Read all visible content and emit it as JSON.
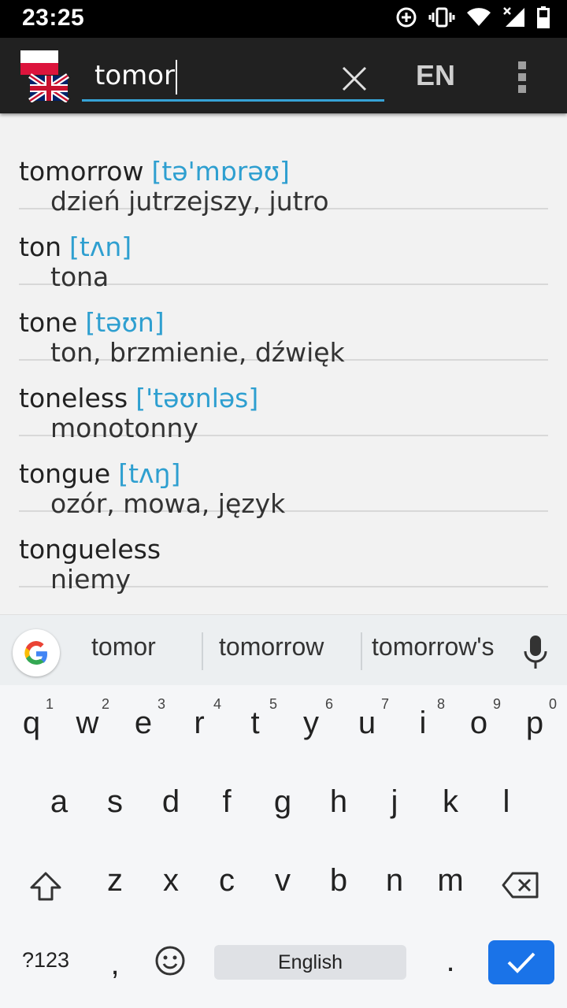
{
  "status_bar": {
    "time": "23:25",
    "icons": [
      "data-saver-icon",
      "vibrate-icon",
      "wifi-icon",
      "signal-x-icon",
      "battery-icon"
    ]
  },
  "app_bar": {
    "search_value": "tomor",
    "language_label": "EN",
    "icons": [
      "pl-en-flags-icon",
      "clear-icon",
      "overflow-menu-icon"
    ]
  },
  "colors": {
    "accent": "#36a3d6",
    "pronunciation": "#2e9fd0",
    "appbar": "#212121",
    "enter_key": "#1a73e8"
  },
  "entries": [
    {
      "word": "tomorrow",
      "pron": "[tə'mɒrəʊ]",
      "translation": "dzień jutrzejszy, jutro"
    },
    {
      "word": "ton",
      "pron": "[tʌn]",
      "translation": "tona"
    },
    {
      "word": "tone",
      "pron": "[təʊn]",
      "translation": "ton, brzmienie, dźwięk"
    },
    {
      "word": "toneless",
      "pron": "['təʊnləs]",
      "translation": "monotonny"
    },
    {
      "word": "tongue",
      "pron": "[tʌŋ]",
      "translation": "ozór, mowa, język"
    },
    {
      "word": "tongueless",
      "pron": "",
      "translation": "niemy"
    }
  ],
  "suggestions": [
    "tomor",
    "tomorrow",
    "tomorrow's"
  ],
  "keyboard": {
    "row1": [
      {
        "k": "q",
        "h": "1"
      },
      {
        "k": "w",
        "h": "2"
      },
      {
        "k": "e",
        "h": "3"
      },
      {
        "k": "r",
        "h": "4"
      },
      {
        "k": "t",
        "h": "5"
      },
      {
        "k": "y",
        "h": "6"
      },
      {
        "k": "u",
        "h": "7"
      },
      {
        "k": "i",
        "h": "8"
      },
      {
        "k": "o",
        "h": "9"
      },
      {
        "k": "p",
        "h": "0"
      }
    ],
    "row2": [
      "a",
      "s",
      "d",
      "f",
      "g",
      "h",
      "j",
      "k",
      "l"
    ],
    "row3": [
      "z",
      "x",
      "c",
      "v",
      "b",
      "n",
      "m"
    ],
    "symbols_label": "?123",
    "comma": ",",
    "period": ".",
    "space_label": "English"
  }
}
